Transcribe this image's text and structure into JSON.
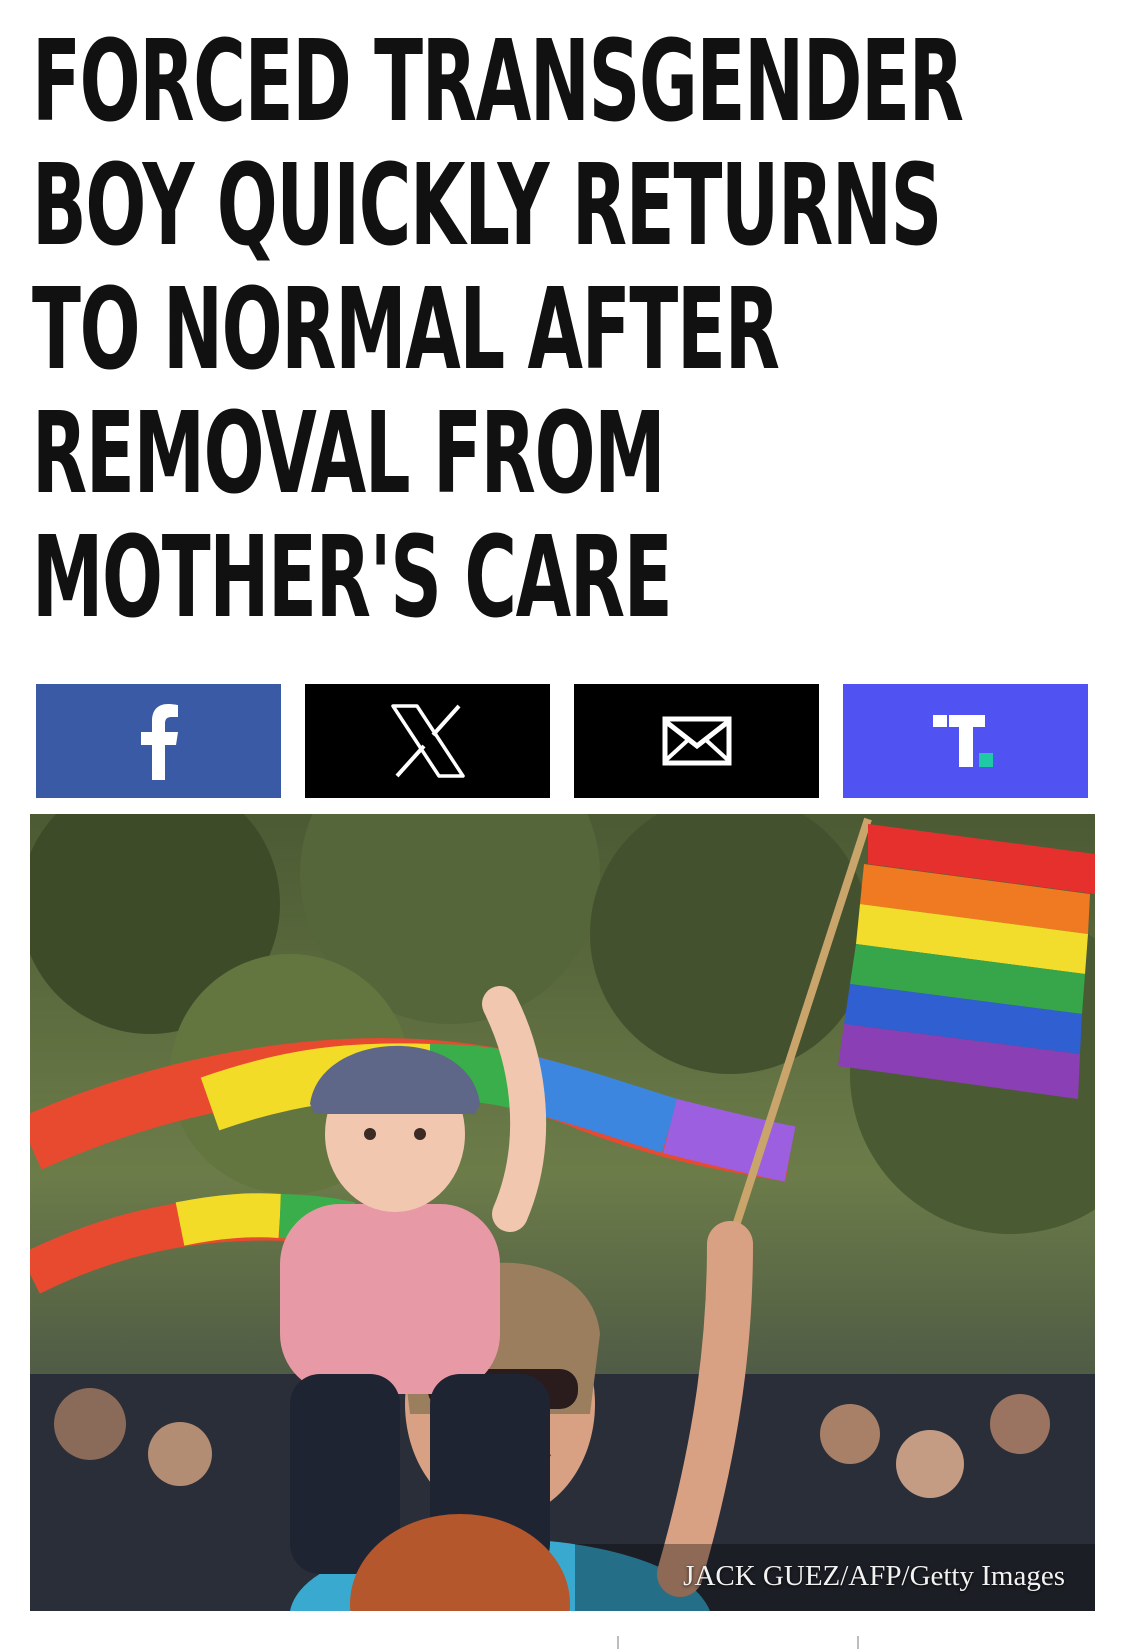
{
  "headline": {
    "lines": [
      "FORCED TRANSGENDER",
      "BOY QUICKLY RETURNS",
      "TO NORMAL AFTER",
      "REMOVAL FROM",
      "MOTHER'S CARE"
    ]
  },
  "share_buttons": [
    {
      "name": "facebook",
      "icon": "facebook-icon",
      "color": "#3b5aa6"
    },
    {
      "name": "x",
      "icon": "x-icon",
      "color": "#000000"
    },
    {
      "name": "email",
      "icon": "email-icon",
      "color": "#000000"
    },
    {
      "name": "truth-social",
      "icon": "truth-social-icon",
      "color": "#5053f2"
    }
  ],
  "photo": {
    "caption": "JACK GUEZ/AFP/Getty Images"
  },
  "colors": {
    "accent_teal": "#20c9a6",
    "headline_text": "#111111"
  }
}
